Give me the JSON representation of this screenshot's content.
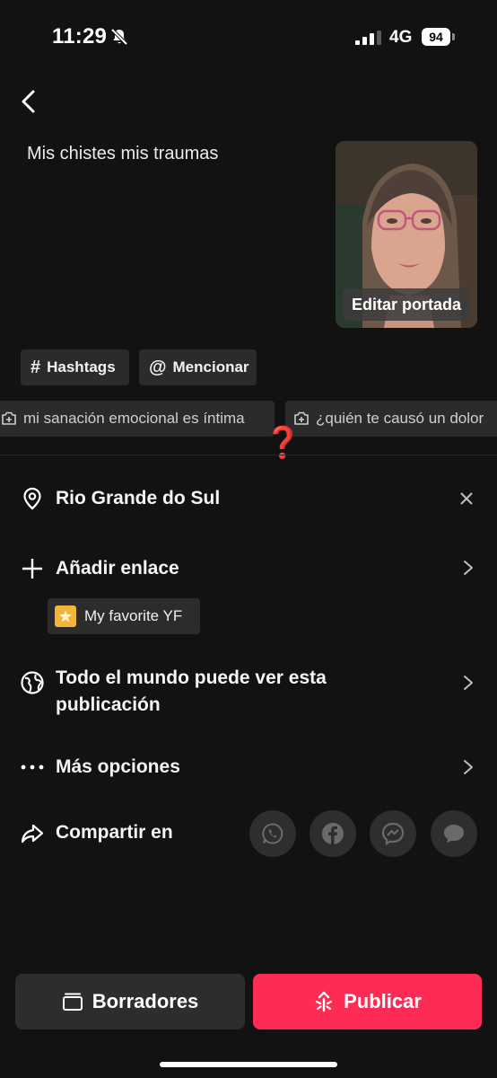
{
  "status_bar": {
    "time": "11:29",
    "network": "4G",
    "battery": "94"
  },
  "post": {
    "caption": "Mis chistes mis traumas",
    "edit_cover_label": "Editar portada"
  },
  "tag_chips": [
    {
      "symbol": "#",
      "label": "Hashtags"
    },
    {
      "symbol": "@",
      "label": "Mencionar"
    }
  ],
  "suggestions": [
    "mi sanación emocional es íntima",
    "¿quién te causó un dolor"
  ],
  "question_mark": "❓",
  "location": {
    "label": "Rio Grande do Sul",
    "icon": "location-pin-icon"
  },
  "add_link": {
    "label": "Añadir enlace",
    "icon": "plus-icon"
  },
  "link_tag": {
    "label": "My favorite YF"
  },
  "privacy": {
    "line1": "Todo el mundo puede ver esta",
    "line2": "publicación",
    "icon": "globe-icon"
  },
  "more_options": {
    "label": "Más opciones",
    "icon": "more-dots-icon"
  },
  "share": {
    "label": "Compartir en",
    "targets": [
      "whatsapp-icon",
      "facebook-icon",
      "messenger-icon",
      "message-icon"
    ]
  },
  "buttons": {
    "drafts": "Borradores",
    "publish": "Publicar"
  },
  "colors": {
    "background": "#121212",
    "publish": "#fe2c55",
    "chip": "#2b2b2b",
    "alert": "#d41a2a"
  }
}
